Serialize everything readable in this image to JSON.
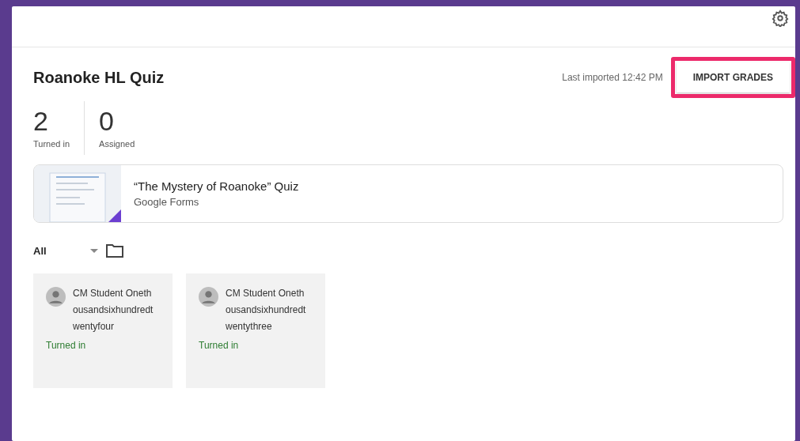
{
  "assignment": {
    "title": "Roanoke HL Quiz",
    "last_imported": "Last imported 12:42 PM",
    "import_button": {
      "label": "IMPORT GRADES",
      "highlighted": true
    }
  },
  "stats": [
    {
      "value": "2",
      "label": "Turned in"
    },
    {
      "value": "0",
      "label": "Assigned"
    }
  ],
  "attachment": {
    "title": "“The Mystery of Roanoke” Quiz",
    "source": "Google Forms"
  },
  "filter": {
    "value": "All"
  },
  "students": [
    {
      "name": "CM Student Onethousandsixhundredtwentyfour",
      "status": "Turned in"
    },
    {
      "name": "CM Student Onethousandsixhundredtwentythree",
      "status": "Turned in"
    }
  ]
}
